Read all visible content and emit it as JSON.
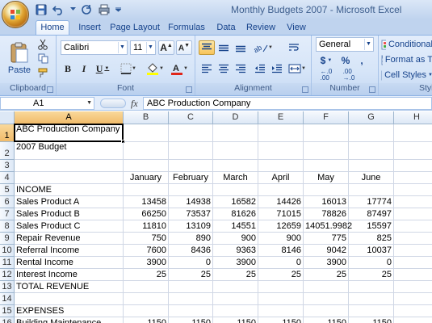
{
  "window": {
    "title": "Monthly Budgets 2007 - Microsoft Excel"
  },
  "ribbon_tabs": [
    {
      "label": "Home",
      "active": true
    },
    {
      "label": "Insert",
      "active": false
    },
    {
      "label": "Page Layout",
      "active": false
    },
    {
      "label": "Formulas",
      "active": false
    },
    {
      "label": "Data",
      "active": false
    },
    {
      "label": "Review",
      "active": false
    },
    {
      "label": "View",
      "active": false
    }
  ],
  "clipboard": {
    "label": "Clipboard",
    "paste_label": "Paste"
  },
  "font": {
    "label": "Font",
    "font_name": "Calibri",
    "font_size": "11"
  },
  "alignment": {
    "label": "Alignment"
  },
  "number": {
    "label": "Number",
    "format": "General"
  },
  "styles": {
    "label": "Style",
    "conditional": "Conditional",
    "format_as": "Format as T",
    "cell_styles": "Cell Styles"
  },
  "formula_bar": {
    "name_box": "A1",
    "fx": "fx",
    "content": "ABC Production Company"
  },
  "columns": [
    "A",
    "B",
    "C",
    "D",
    "E",
    "F",
    "G",
    "H"
  ],
  "selected_column": "A",
  "selected_row": "1",
  "rows": [
    {
      "n": "1",
      "a": "ABC Production Company",
      "v": [
        "",
        "",
        "",
        "",
        "",
        ""
      ]
    },
    {
      "n": "2",
      "a": "2007 Budget",
      "v": [
        "",
        "",
        "",
        "",
        "",
        ""
      ]
    },
    {
      "n": "3",
      "a": "",
      "v": [
        "",
        "",
        "",
        "",
        "",
        ""
      ]
    },
    {
      "n": "4",
      "a": "",
      "v": [
        "January",
        "February",
        "March",
        "April",
        "May",
        "June"
      ],
      "center": true
    },
    {
      "n": "5",
      "a": "INCOME",
      "v": [
        "",
        "",
        "",
        "",
        "",
        ""
      ]
    },
    {
      "n": "6",
      "a": "Sales Product A",
      "v": [
        "13458",
        "14938",
        "16582",
        "14426",
        "16013",
        "17774"
      ]
    },
    {
      "n": "7",
      "a": "Sales Product B",
      "v": [
        "66250",
        "73537",
        "81626",
        "71015",
        "78826",
        "87497"
      ]
    },
    {
      "n": "8",
      "a": "Sales Product C",
      "v": [
        "11810",
        "13109",
        "14551",
        "12659",
        "14051.9982",
        "15597"
      ]
    },
    {
      "n": "9",
      "a": "Repair Revenue",
      "v": [
        "750",
        "890",
        "900",
        "900",
        "775",
        "825"
      ]
    },
    {
      "n": "10",
      "a": "Referral Income",
      "v": [
        "7600",
        "8436",
        "9363",
        "8146",
        "9042",
        "10037"
      ]
    },
    {
      "n": "11",
      "a": "Rental Income",
      "v": [
        "3900",
        "0",
        "3900",
        "0",
        "3900",
        "0"
      ]
    },
    {
      "n": "12",
      "a": "Interest Income",
      "v": [
        "25",
        "25",
        "25",
        "25",
        "25",
        "25"
      ]
    },
    {
      "n": "13",
      "a": "TOTAL REVENUE",
      "v": [
        "",
        "",
        "",
        "",
        "",
        ""
      ]
    },
    {
      "n": "14",
      "a": "",
      "v": [
        "",
        "",
        "",
        "",
        "",
        ""
      ]
    },
    {
      "n": "15",
      "a": "EXPENSES",
      "v": [
        "",
        "",
        "",
        "",
        "",
        ""
      ]
    },
    {
      "n": "16",
      "a": "Building Maintenance",
      "v": [
        "1150",
        "1150",
        "1150",
        "1150",
        "1150",
        "1150"
      ]
    }
  ]
}
